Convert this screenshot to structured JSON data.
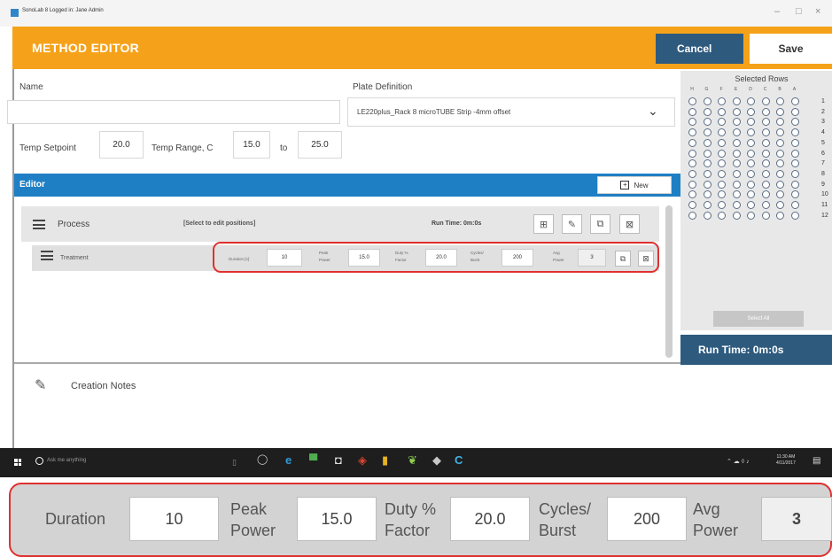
{
  "window": {
    "title": "SonoLab 8 Logged in: Jane Admin",
    "minimize": "–",
    "maximize": "□",
    "close": "×"
  },
  "header": {
    "title": "METHOD EDITOR",
    "cancel_label": "Cancel",
    "save_label": "Save"
  },
  "form": {
    "name_label": "Name",
    "name_value": "",
    "plate_label": "Plate Definition",
    "plate_value": "LE220plus_Rack 8 microTUBE Strip -4mm offset",
    "temp_setpoint_label": "Temp Setpoint",
    "temp_setpoint_value": "20.0",
    "temp_range_label": "Temp Range, C",
    "temp_range_min": "15.0",
    "temp_to_label": "to",
    "temp_range_max": "25.0"
  },
  "editor": {
    "title": "Editor",
    "new_label": "New",
    "process": {
      "label": "Process",
      "hint": "[Select to edit positions]",
      "run_time": "Run Time: 0m:0s"
    },
    "treatment": {
      "label": "Treatment",
      "duration_label": "Duration [s]",
      "duration": "10",
      "peak_power_label_1": "Peak",
      "peak_power_label_2": "Power",
      "peak_power": "15.0",
      "duty_label_1": "Duty %",
      "duty_label_2": "Factor",
      "duty": "20.0",
      "cycles_label_1": "Cycles/",
      "cycles_label_2": "Burst",
      "cycles": "200",
      "avg_label_1": "Avg",
      "avg_label_2": "Power",
      "avg_power": "3"
    }
  },
  "notes": {
    "label": "Creation Notes"
  },
  "selected_rows": {
    "title": "Selected Rows",
    "columns": [
      "H",
      "G",
      "F",
      "E",
      "D",
      "C",
      "B",
      "A"
    ],
    "rows": [
      "1",
      "2",
      "3",
      "4",
      "5",
      "6",
      "7",
      "8",
      "9",
      "10",
      "11",
      "12"
    ],
    "select_all_label": "Select All",
    "run_time": "Run Time: 0m:0s"
  },
  "taskbar": {
    "search_placeholder": "Ask me anything",
    "time": "11:30 AM",
    "date": "4/11/2017"
  },
  "zoom": {
    "duration_label": "Duration",
    "duration": "10",
    "peak_label_1": "Peak",
    "peak_label_2": "Power",
    "peak": "15.0",
    "duty_label_1": "Duty %",
    "duty_label_2": "Factor",
    "duty": "20.0",
    "cycles_label_1": "Cycles/",
    "cycles_label_2": "Burst",
    "cycles": "200",
    "avg_label_1": "Avg",
    "avg_label_2": "Power",
    "avg": "3"
  },
  "colors": {
    "header_orange": "#f5a21a",
    "editor_blue": "#1f7fc4",
    "dark_blue": "#2e5a7e",
    "highlight_red": "#e03030"
  }
}
